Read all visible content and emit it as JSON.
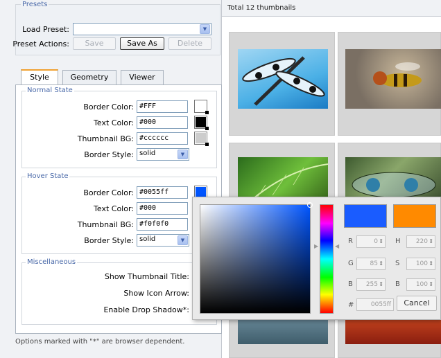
{
  "presets": {
    "legend": "Presets",
    "load_label": "Load Preset:",
    "load_value": "",
    "actions_label": "Preset Actions:",
    "save": "Save",
    "save_as": "Save As",
    "delete": "Delete"
  },
  "tabs": [
    "Style",
    "Geometry",
    "Viewer"
  ],
  "normal": {
    "legend": "Normal State",
    "border_label": "Border Color:",
    "border_value": "#FFF",
    "text_label": "Text Color:",
    "text_value": "#000",
    "bg_label": "Thumbnail BG:",
    "bg_value": "#cccccc",
    "style_label": "Border Style:",
    "style_value": "solid"
  },
  "hover": {
    "legend": "Hover State",
    "border_label": "Border Color:",
    "border_value": "#0055ff",
    "text_label": "Text Color:",
    "text_value": "#000",
    "bg_label": "Thumbnail BG:",
    "bg_value": "#f0f0f0",
    "style_label": "Border Style:",
    "style_value": "solid"
  },
  "misc": {
    "legend": "Miscellaneous",
    "show_title": "Show Thumbnail Title:",
    "show_arrow": "Show Icon Arrow:",
    "drop_shadow": "Enable Drop Shadow*:"
  },
  "footnote": "Options marked with \"*\" are browser dependent.",
  "thumbs_header": "Total 12 thumbnails",
  "picker": {
    "r_label": "R",
    "r_value": "0",
    "g_label": "G",
    "g_value": "85",
    "b_label": "B",
    "b_value": "255",
    "h_label": "H",
    "h_value": "220",
    "s_label": "S",
    "s_value": "100",
    "v_label": "B",
    "v_value": "100",
    "hex_label": "#",
    "hex_value": "0055ff",
    "cancel": "Cancel",
    "new_color": "#1a5cff",
    "old_color": "#ff8a00"
  },
  "colors": {
    "accent": "#4868a8",
    "tab_highlight": "#f0a030"
  }
}
